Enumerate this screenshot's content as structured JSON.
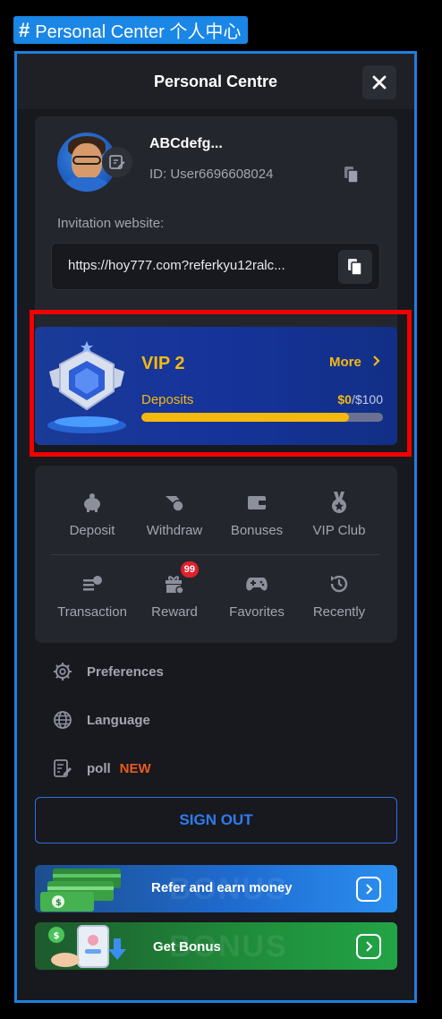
{
  "tag": {
    "icon": "hash-icon",
    "text": "Personal Center 个人中心"
  },
  "header": {
    "title": "Personal Centre",
    "close_icon": "close-icon"
  },
  "profile": {
    "username": "ABCdefg...",
    "user_id": "ID: User6696608024",
    "invite_label": "Invitation website:",
    "invite_url": "https://hoy777.com?referkyu12ralc..."
  },
  "vip": {
    "level": "VIP 2",
    "more_label": "More",
    "deposits_label": "Deposits",
    "deposits_current": "$0",
    "deposits_total": "/$100",
    "progress_fraction": 0.86
  },
  "quick_actions": [
    {
      "label": "Deposit",
      "icon": "piggy-bank-icon"
    },
    {
      "label": "Withdraw",
      "icon": "withdraw-icon"
    },
    {
      "label": "Bonuses",
      "icon": "wallet-icon"
    },
    {
      "label": "VIP Club",
      "icon": "medal-icon"
    },
    {
      "label": "Transaction",
      "icon": "transaction-icon"
    },
    {
      "label": "Reward",
      "icon": "gift-icon",
      "badge": "99"
    },
    {
      "label": "Favorites",
      "icon": "gamepad-icon"
    },
    {
      "label": "Recently",
      "icon": "history-icon"
    }
  ],
  "menu": {
    "preferences": "Preferences",
    "language": "Language",
    "poll": "poll",
    "poll_tag": "NEW"
  },
  "signout_label": "SIGN OUT",
  "promos": {
    "refer": "Refer and earn money",
    "bonus": "Get Bonus",
    "watermark": "BONUS"
  },
  "colors": {
    "accent_blue": "#1f7fe0",
    "vip_gold": "#f5b90e",
    "highlight_red": "#f20000",
    "new_orange": "#e85a20",
    "badge_red": "#e2202d"
  }
}
